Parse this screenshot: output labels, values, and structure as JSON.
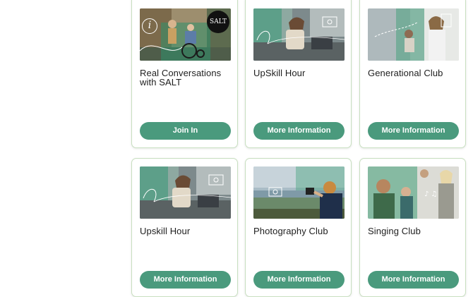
{
  "cards": [
    {
      "title": "Real Conversations with SALT",
      "button": "Join In",
      "badge": "SALT"
    },
    {
      "title": "UpSkill Hour",
      "button": "More Information"
    },
    {
      "title": "Generational Club",
      "button": "More Information"
    },
    {
      "title": "Upskill Hour",
      "button": "More Information"
    },
    {
      "title": "Photography Club",
      "button": "More Information"
    },
    {
      "title": "Singing Club",
      "button": "More Information"
    }
  ],
  "colors": {
    "button": "#4a9a7d",
    "card_border": "#c8dfc0",
    "title_text": "#1e1e1e"
  }
}
